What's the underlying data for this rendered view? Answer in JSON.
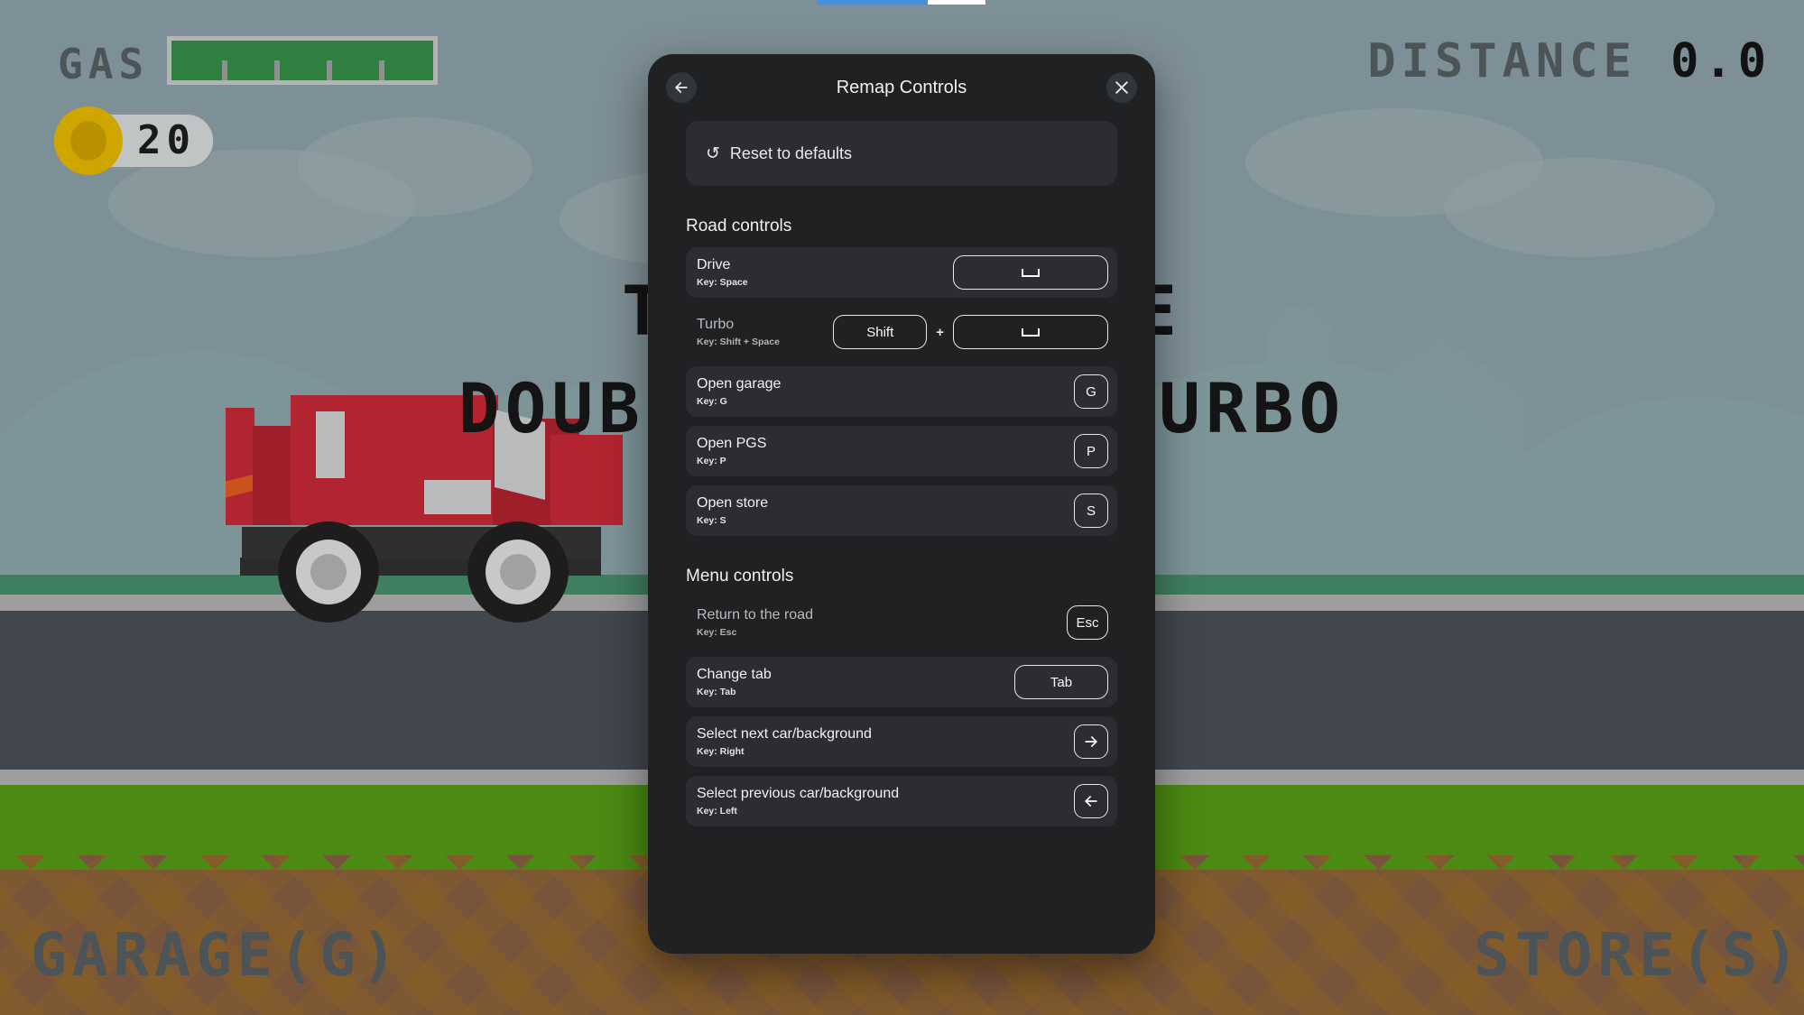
{
  "loading_bar": {
    "progress_percent": 66
  },
  "game_hud": {
    "gas_label": "GAS",
    "gas_percent": 100,
    "coin_count": "20",
    "distance_label": "DISTANCE",
    "distance_value": "0.0",
    "hint_line1": "TAP TO DRIVE",
    "hint_line2": "DOUBLE TAP TO TURBO",
    "garage_label": "GARAGE(G)",
    "store_label": "STORE(S)",
    "colors": {
      "sky": "#7e9097",
      "grass": "#3f7f5f",
      "road": "#41474d",
      "curb": "#9e9e9e",
      "field": "#4b8a13",
      "dirt": "#77543a",
      "gas_fill": "#2f8040",
      "coin": "#cfa600",
      "car_body": "#b2242f"
    }
  },
  "dialog": {
    "title": "Remap Controls",
    "back_icon": "arrow-left-icon",
    "close_icon": "close-icon",
    "reset": {
      "icon": "refresh-icon",
      "label": "Reset to defaults"
    },
    "sections": [
      {
        "title": "Road controls",
        "rows": [
          {
            "label": "Drive",
            "key_text": "Key: Space",
            "highlighted": true,
            "dim": false,
            "keys": [
              {
                "type": "space",
                "label": "",
                "size": "wide"
              }
            ]
          },
          {
            "label": "Turbo",
            "key_text": "Key: Shift + Space",
            "highlighted": false,
            "dim": true,
            "keys": [
              {
                "type": "text",
                "label": "Shift",
                "size": "mid"
              },
              {
                "type": "plus",
                "label": "+"
              },
              {
                "type": "space",
                "label": "",
                "size": "wide"
              }
            ]
          },
          {
            "label": "Open garage",
            "key_text": "Key: G",
            "highlighted": true,
            "dim": false,
            "keys": [
              {
                "type": "text",
                "label": "G",
                "size": "sq"
              }
            ]
          },
          {
            "label": "Open PGS",
            "key_text": "Key: P",
            "highlighted": true,
            "dim": false,
            "keys": [
              {
                "type": "text",
                "label": "P",
                "size": "sq"
              }
            ]
          },
          {
            "label": "Open store",
            "key_text": "Key: S",
            "highlighted": true,
            "dim": false,
            "keys": [
              {
                "type": "text",
                "label": "S",
                "size": "sq"
              }
            ]
          }
        ]
      },
      {
        "title": "Menu controls",
        "rows": [
          {
            "label": "Return to the road",
            "key_text": "Key: Esc",
            "highlighted": false,
            "dim": true,
            "keys": [
              {
                "type": "text",
                "label": "Esc",
                "size": "esc"
              }
            ]
          },
          {
            "label": "Change tab",
            "key_text": "Key: Tab",
            "highlighted": true,
            "dim": false,
            "keys": [
              {
                "type": "text",
                "label": "Tab",
                "size": "tabcap"
              }
            ]
          },
          {
            "label": "Select next car/background",
            "key_text": "Key: Right",
            "highlighted": true,
            "dim": false,
            "keys": [
              {
                "type": "arrow-right",
                "label": "",
                "size": "sq"
              }
            ]
          },
          {
            "label": "Select previous car/background",
            "key_text": "Key: Left",
            "highlighted": true,
            "dim": false,
            "keys": [
              {
                "type": "arrow-left",
                "label": "",
                "size": "sq"
              }
            ]
          }
        ]
      }
    ]
  }
}
